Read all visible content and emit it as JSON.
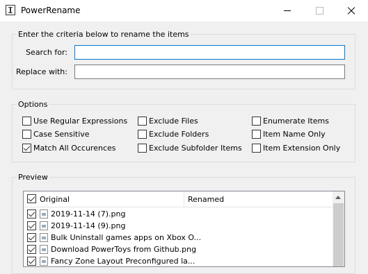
{
  "window": {
    "title": "PowerRename"
  },
  "criteria": {
    "legend": "Enter the criteria below to rename the items",
    "search_label": "Search for:",
    "search_value": "",
    "replace_label": "Replace with:",
    "replace_value": ""
  },
  "options": {
    "legend": "Options",
    "items": [
      {
        "label": "Use Regular Expressions",
        "checked": false
      },
      {
        "label": "Case Sensitive",
        "checked": false
      },
      {
        "label": "Match All Occurences",
        "checked": true
      },
      {
        "label": "Exclude Files",
        "checked": false
      },
      {
        "label": "Exclude Folders",
        "checked": false
      },
      {
        "label": "Exclude Subfolder Items",
        "checked": false
      },
      {
        "label": "Enumerate Items",
        "checked": false
      },
      {
        "label": "Item Name Only",
        "checked": false
      },
      {
        "label": "Item Extension Only",
        "checked": false
      }
    ]
  },
  "preview": {
    "legend": "Preview",
    "col_original": "Original",
    "col_renamed": "Renamed",
    "header_checked": true,
    "rows": [
      {
        "name": "2019-11-14 (7).png",
        "checked": true
      },
      {
        "name": "2019-11-14 (9).png",
        "checked": true
      },
      {
        "name": "Bulk Uninstall games apps on Xbox O...",
        "checked": true
      },
      {
        "name": "Download PowerToys from Github.png",
        "checked": true
      },
      {
        "name": "Fancy Zone Layout Preconfigured la...",
        "checked": true
      }
    ]
  }
}
